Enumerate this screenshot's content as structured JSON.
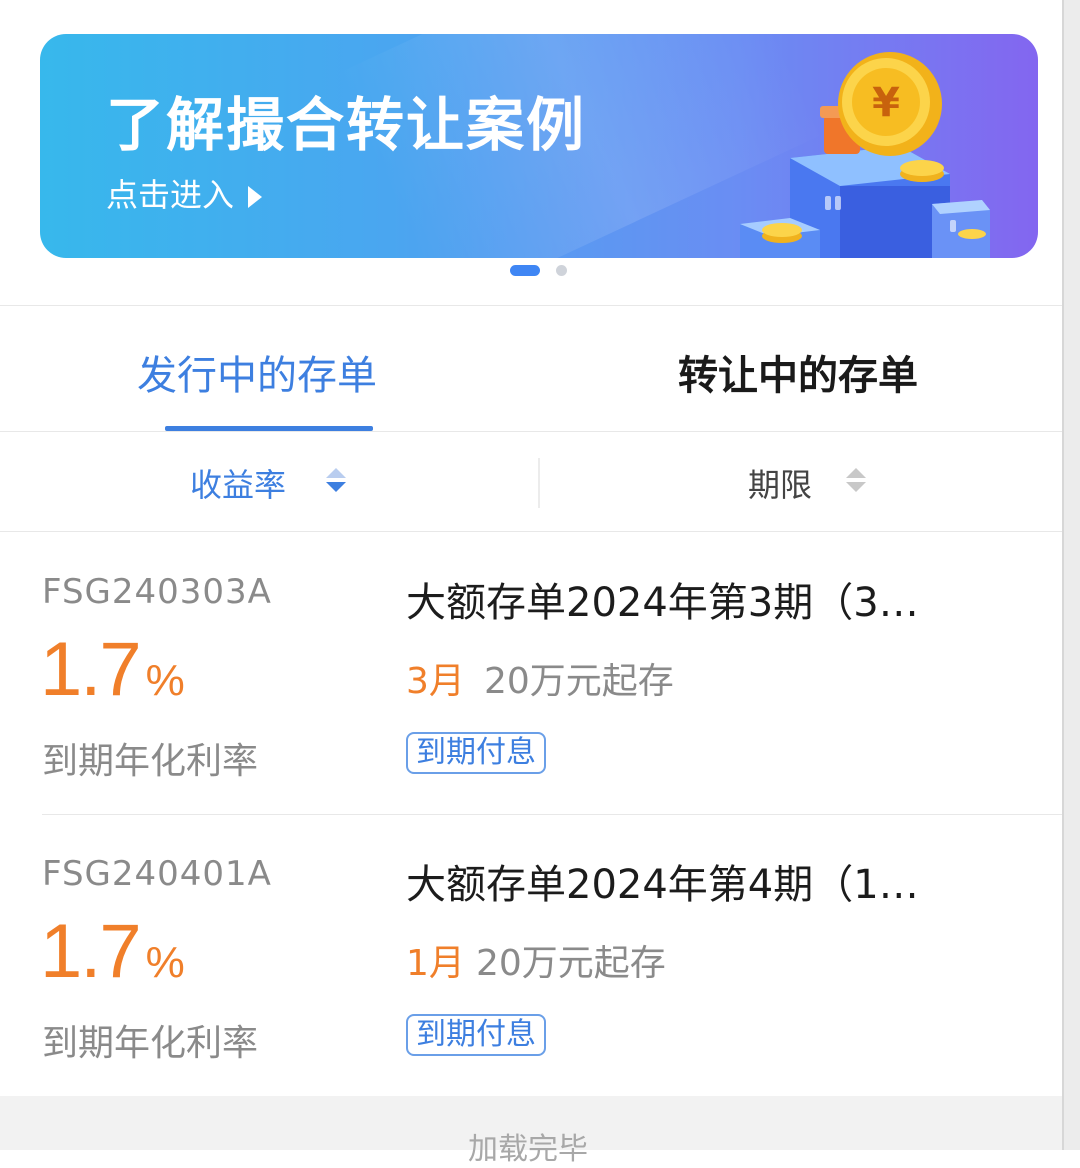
{
  "banner": {
    "title": "了解撮合转让案例",
    "subtitle": "点击进入",
    "carousel_dots": 2,
    "active_dot": 1
  },
  "tabs": [
    {
      "label": "发行中的存单",
      "active": true
    },
    {
      "label": "转让中的存单",
      "active": false
    }
  ],
  "sort": {
    "rate_label": "收益率",
    "term_label": "期限"
  },
  "products": [
    {
      "code": "FSG240303A",
      "rate": "1.7",
      "rate_unit": "%",
      "rate_label": "到期年化利率",
      "name": "大额存单2024年第3期（3…",
      "term": "3月",
      "min_deposit": "20万元起存",
      "tag": "到期付息"
    },
    {
      "code": "FSG240401A",
      "rate": "1.7",
      "rate_unit": "%",
      "rate_label": "到期年化利率",
      "name": "大额存单2024年第4期（1…",
      "term": "1月",
      "min_deposit": "20万元起存",
      "tag": "到期付息"
    }
  ],
  "footer": {
    "status": "加载完毕"
  },
  "colors": {
    "accent": "#3d7fe0",
    "rate": "#f07f2a",
    "muted": "#8a8a8a"
  }
}
